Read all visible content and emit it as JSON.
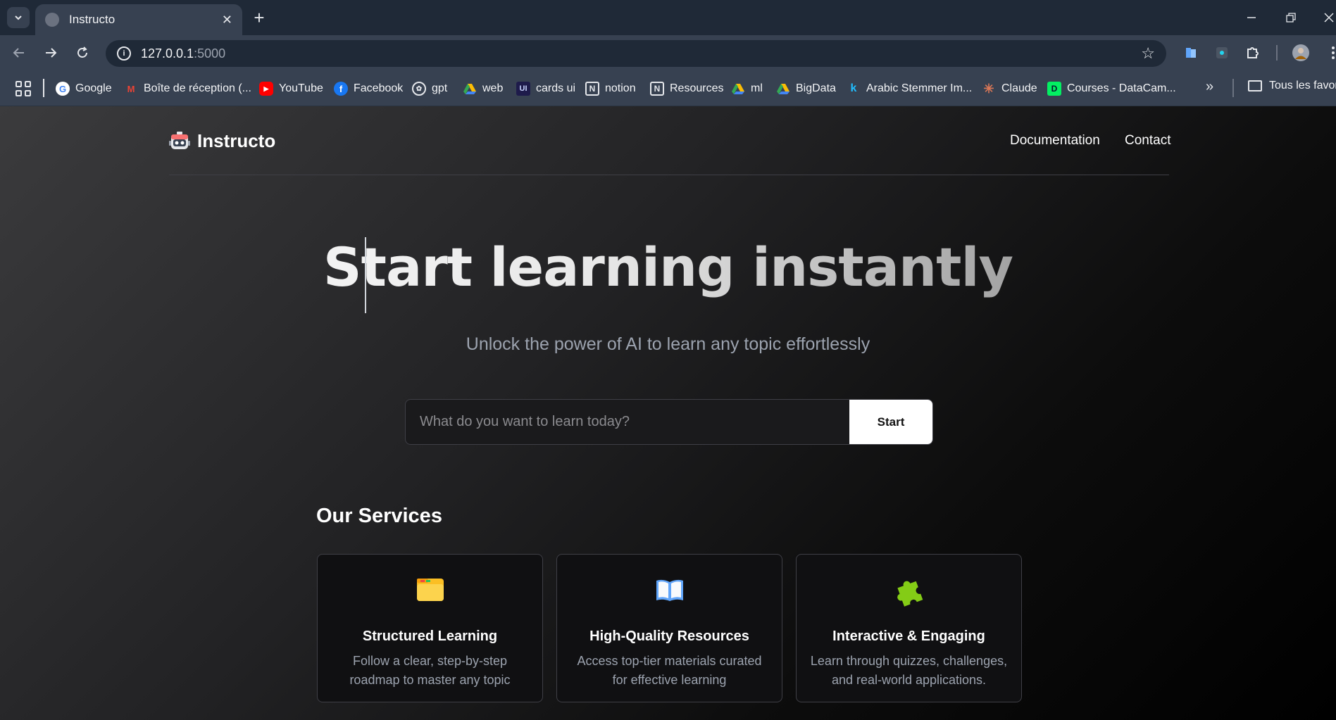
{
  "browser": {
    "tab_title": "Instructo",
    "url_host": "127.0.0.1",
    "url_port": ":5000",
    "bookmarks": [
      {
        "label": "Google",
        "icon": "google-icon"
      },
      {
        "label": "Boîte de réception (...",
        "icon": "gmail-icon"
      },
      {
        "label": "YouTube",
        "icon": "youtube-icon"
      },
      {
        "label": "Facebook",
        "icon": "facebook-icon"
      },
      {
        "label": "gpt",
        "icon": "openai-icon"
      },
      {
        "label": "web",
        "icon": "drive-icon"
      },
      {
        "label": "cards ui",
        "icon": "ui-icon"
      },
      {
        "label": "notion",
        "icon": "notion-icon"
      },
      {
        "label": "Resources",
        "icon": "notion-icon"
      },
      {
        "label": "ml",
        "icon": "drive-icon"
      },
      {
        "label": "BigData",
        "icon": "drive-icon"
      },
      {
        "label": "Arabic Stemmer Im...",
        "icon": "kaggle-icon"
      },
      {
        "label": "Claude",
        "icon": "claude-icon"
      },
      {
        "label": "Courses - DataCam...",
        "icon": "datacamp-icon"
      }
    ],
    "bookmarks_folder": "Tous les favori"
  },
  "nav": {
    "brand": "Instructo",
    "links": [
      "Documentation",
      "Contact"
    ]
  },
  "hero": {
    "title": "Start learning instantly",
    "subtitle": "Unlock the power of AI to learn any topic effortlessly",
    "search_placeholder": "What do you want to learn today?",
    "search_value": "",
    "start_label": "Start"
  },
  "services": {
    "title": "Our Services",
    "cards": [
      {
        "icon": "folder-icon",
        "title": "Structured Learning",
        "line1": "Follow a clear, step-by-step",
        "line2": "roadmap to master any topic"
      },
      {
        "icon": "book-icon",
        "title": "High-Quality Resources",
        "line1": "Access top-tier materials curated",
        "line2": "for effective learning"
      },
      {
        "icon": "puzzle-icon",
        "title": "Interactive & Engaging",
        "line1": "Learn through quizzes, challenges,",
        "line2": "and real-world applications."
      }
    ]
  },
  "colors": {
    "chrome_dark": "#1f2937",
    "chrome_light": "#374151",
    "page_text_muted": "#9ca3af",
    "button_bg": "#ffffff"
  }
}
